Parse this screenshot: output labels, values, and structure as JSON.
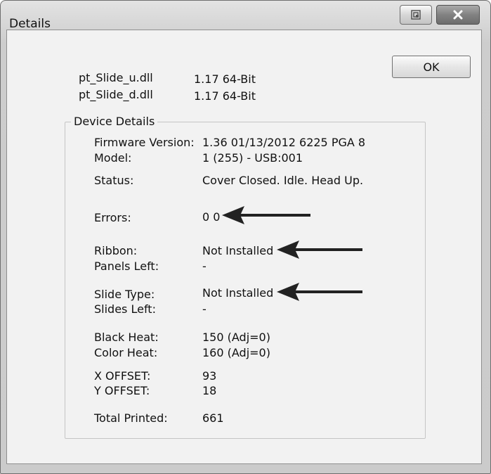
{
  "window": {
    "title": "Details",
    "ok_label": "OK"
  },
  "dlls": [
    {
      "name": "pt_Slide_u.dll",
      "version": "1.17  64-Bit"
    },
    {
      "name": "pt_Slide_d.dll",
      "version": "1.17  64-Bit"
    }
  ],
  "device": {
    "group_label": "Device Details",
    "firmware": {
      "label": "Firmware Version:",
      "value": "1.36 01/13/2012  6225  PGA 8"
    },
    "model": {
      "label": "Model:",
      "value": "1 (255) - USB:001"
    },
    "status": {
      "label": "Status:",
      "value": "Cover Closed. Idle. Head Up."
    },
    "errors": {
      "label": "Errors:",
      "value": "0 0"
    },
    "ribbon": {
      "label": "Ribbon:",
      "value": "Not Installed"
    },
    "panels_left": {
      "label": "Panels Left:",
      "value": "-"
    },
    "slide_type": {
      "label": "Slide Type:",
      "value": "Not Installed"
    },
    "slides_left": {
      "label": "Slides Left:",
      "value": "-"
    },
    "black_heat": {
      "label": "Black Heat:",
      "value": "150  (Adj=0)"
    },
    "color_heat": {
      "label": "Color Heat:",
      "value": "160  (Adj=0)"
    },
    "x_offset": {
      "label": "X OFFSET:",
      "value": "93"
    },
    "y_offset": {
      "label": "Y OFFSET:",
      "value": "18"
    },
    "total_printed": {
      "label": "Total  Printed:",
      "value": "661"
    }
  }
}
